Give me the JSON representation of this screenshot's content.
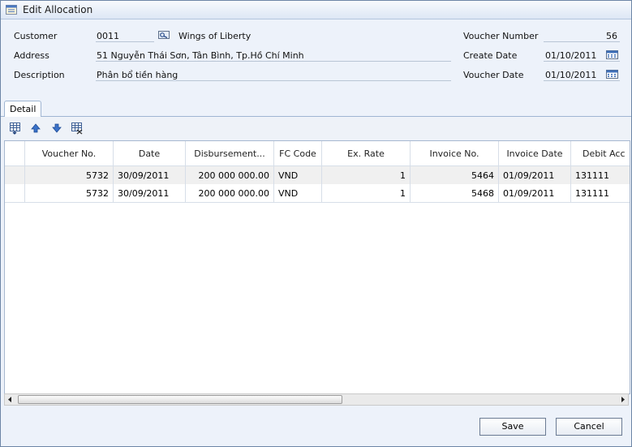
{
  "window": {
    "title": "Edit Allocation"
  },
  "form": {
    "customer_label": "Customer",
    "customer_code": "0011",
    "customer_name": "Wings of Liberty",
    "address_label": "Address",
    "address": "51 Nguyễn Thái Sơn, Tân Bình, Tp.Hồ Chí Minh",
    "description_label": "Description",
    "description": "Phân bổ tiền hàng",
    "voucher_number_label": "Voucher Number",
    "voucher_number": "56",
    "create_date_label": "Create Date",
    "create_date": "01/10/2011",
    "voucher_date_label": "Voucher Date",
    "voucher_date": "01/10/2011"
  },
  "tabs": [
    {
      "label": "Detail"
    }
  ],
  "toolbar": {
    "icons": [
      "insert-row-icon",
      "move-up-icon",
      "move-down-icon",
      "delete-row-icon"
    ]
  },
  "grid": {
    "columns": [
      "Voucher No.",
      "Date",
      "Disbursement...",
      "FC Code",
      "Ex. Rate",
      "Invoice No.",
      "Invoice Date",
      "Debit Acc"
    ],
    "rows": [
      [
        "5732",
        "30/09/2011",
        "200 000 000.00",
        "VND",
        "1",
        "5464",
        "01/09/2011",
        "131111"
      ],
      [
        "5732",
        "30/09/2011",
        "200 000 000.00",
        "VND",
        "1",
        "5468",
        "01/09/2011",
        "131111"
      ]
    ]
  },
  "buttons": {
    "save": "Save",
    "cancel": "Cancel"
  },
  "colors": {
    "window_bg": "#edf2fa",
    "border": "#6d86a6",
    "accent": "#1b5fbf"
  }
}
